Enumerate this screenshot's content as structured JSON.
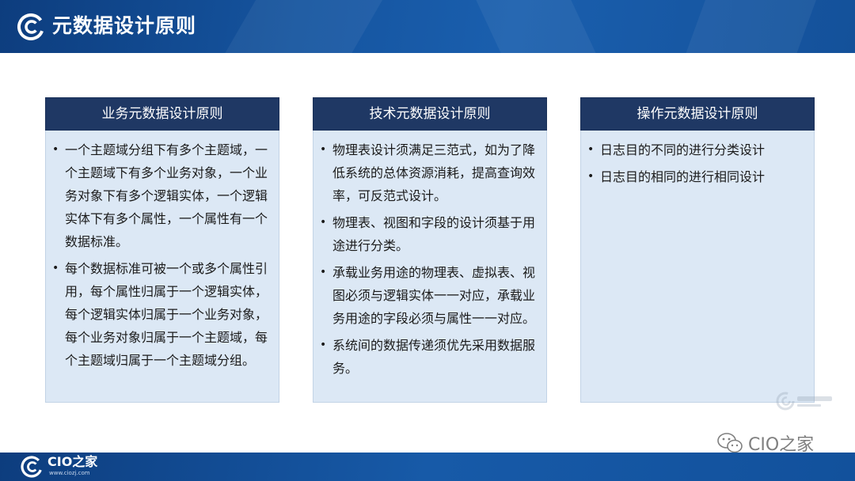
{
  "header": {
    "title": "元数据设计原则",
    "logo_icon": "cio-logo-icon"
  },
  "columns": [
    {
      "title": "业务元数据设计原则",
      "items": [
        "一个主题域分组下有多个主题域，一个主题域下有多个业务对象，一个业务对象下有多个逻辑实体，一个逻辑实体下有多个属性，一个属性有一个数据标准。",
        "每个数据标准可被一个或多个属性引用，每个属性归属于一个逻辑实体，每个逻辑实体归属于一个业务对象，每个业务对象归属于一个主题域，每个主题域归属于一个主题域分组。"
      ]
    },
    {
      "title": "技术元数据设计原则",
      "items": [
        "物理表设计须满足三范式，如为了降低系统的总体资源消耗，提高查询效率，可反范式设计。",
        "物理表、视图和字段的设计须基于用途进行分类。",
        "承载业务用途的物理表、虚拟表、视图必须与逻辑实体一一对应，承载业务用途的字段必须与属性一一对应。",
        "系统间的数据传递须优先采用数据服务。"
      ]
    },
    {
      "title": "操作元数据设计原则",
      "items": [
        "日志目的不同的进行分类设计",
        "日志目的相同的进行相同设计"
      ]
    }
  ],
  "bullet_char": "•",
  "watermark": {
    "wechat_text": "CIO之家",
    "wechat_icon": "wechat-icon"
  },
  "footer": {
    "brand": "CIO之家",
    "url": "www.ciozj.com",
    "logo_icon": "cio-logo-icon"
  },
  "colors": {
    "header_blue": "#15549f",
    "column_header": "#1f3864",
    "column_body": "#dce8f5"
  }
}
